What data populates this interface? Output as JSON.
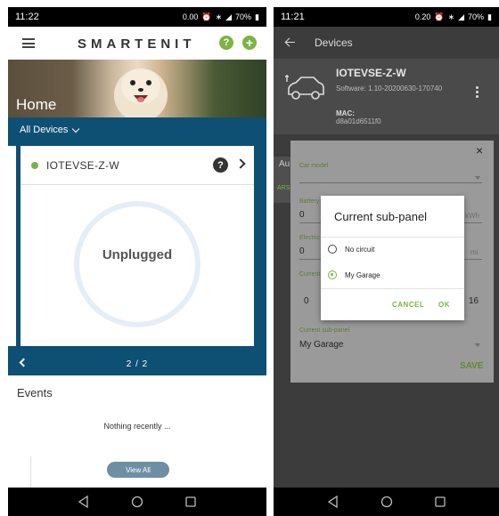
{
  "left": {
    "status": {
      "time": "11:22",
      "net": "0.00",
      "battery": "70%"
    },
    "appbar": {
      "logo": "SMARTENIT",
      "help": "?",
      "add": "+"
    },
    "hero": {
      "title": "Home"
    },
    "devices": {
      "filter_label": "All Devices",
      "card": {
        "name": "IOTEVSE-Z-W",
        "status_color": "#7cb342",
        "help": "?",
        "state": "Unplugged"
      },
      "pager": "2 / 2"
    },
    "events": {
      "title": "Events",
      "empty_text": "Nothing recently ...",
      "view_all": "View All"
    }
  },
  "right": {
    "status": {
      "time": "11:21",
      "net": "0.20",
      "battery": "70%"
    },
    "appbar": {
      "title": "Devices"
    },
    "device": {
      "name": "IOTEVSE-Z-W",
      "software": "Software: 1.10-20200630-170740",
      "mac_label": "MAC:",
      "mac": "d8a01d6511f0"
    },
    "sheet": {
      "close": "×",
      "tab_partial": "Au",
      "tab_partial2": "ARS",
      "car_model_label": "Car model",
      "battery_label": "Battery capacity",
      "battery_value": "0",
      "battery_unit": "kWh",
      "electric_label": "Electric",
      "electric_value": "0",
      "electric_unit": "mi",
      "current_label": "Current",
      "current_min": "0",
      "current_max": "16",
      "subpanel_label": "Current sub-panel",
      "subpanel_value": "My Garage",
      "save": "SAVE"
    },
    "dialog": {
      "title": "Current sub-panel",
      "options": [
        {
          "label": "No circuit",
          "selected": false
        },
        {
          "label": "My Garage",
          "selected": true
        }
      ],
      "cancel": "CANCEL",
      "ok": "OK"
    }
  },
  "colors": {
    "accent": "#7cb342",
    "brand_blue": "#0e4f74"
  }
}
